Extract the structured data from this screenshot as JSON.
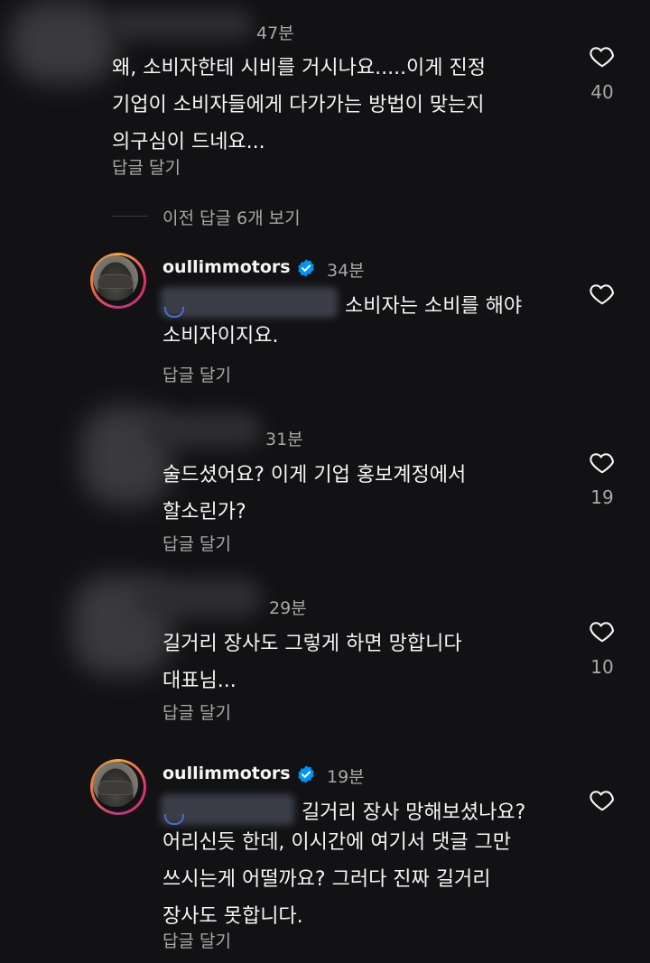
{
  "labels": {
    "reply": "답글 달기"
  },
  "view_previous": "이전 답글 6개 보기",
  "comments": [
    {
      "time": "47분",
      "text": "왜, 소비자한테 시비를 거시나요.....이게 진정\n기업이 소비자들에게 다가가는 방법이 맞는지\n의구심이 드네요...",
      "likes": "40"
    },
    {
      "username": "oullimmotors",
      "time": "34분",
      "text_line1": "소비자는 소비를 해야",
      "text_rest": "소비자이지요."
    },
    {
      "time": "31분",
      "text": "술드셨어요? 이게 기업 홍보계정에서\n할소린가?",
      "likes": "19"
    },
    {
      "time": "29분",
      "text": "길거리 장사도 그렇게 하면 망합니다\n대표님...",
      "likes": "10"
    },
    {
      "username": "oullimmotors",
      "time": "19분",
      "text_line1": "길거리 장사 망해보셨나요?",
      "text_rest": "어리신듯 한데, 이시간에 여기서 댓글 그만\n쓰시는게 어떨까요? 그러다 진짜 길거리\n장사도 못합니다."
    }
  ],
  "colors": {
    "background": "#121214",
    "text": "#f5f5f5",
    "muted": "#a8a8a8",
    "verified": "#0095f6"
  },
  "icons": {
    "like": "heart-outline-icon",
    "verified": "verified-badge-icon"
  }
}
